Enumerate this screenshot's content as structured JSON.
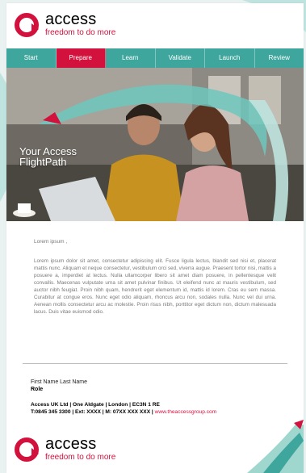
{
  "logo": {
    "brand": "access",
    "tagline": "freedom to do more"
  },
  "nav": [
    {
      "label": "Start",
      "active": false
    },
    {
      "label": "Prepare",
      "active": true
    },
    {
      "label": "Learn",
      "active": false
    },
    {
      "label": "Validate",
      "active": false
    },
    {
      "label": "Launch",
      "active": false
    },
    {
      "label": "Review",
      "active": false
    }
  ],
  "hero": {
    "title_line1": "Your Access",
    "title_line2": "FlightPath"
  },
  "email": {
    "greeting": "Lorem ipsum ,",
    "body": "Lorem ipsum dolor sit amet, consectetur adipiscing elit. Fusce ligula lectus, blandit sed nisi et, placerat mattis nunc. Aliquam et neque consectetur, vestibulum orci sed, viverra augue. Praesent tortor nisi, mattis a posuere a, imperdiet at lectus. Nulla ullamcorper libero sit amet diam posuere, in pellentesque velit convallis. Maecenas vulputate urna sit amet pulvinar finibus. Ut eleifend nunc at mauris vestibulum, sed auctor nibh feugiat. Proin nibh quam, hendrerit eget elementum id, mattis id lorem. Cras eu sem massa. Curabitur at congue eros. Nunc eget odio aliquam, rhoncus arcu non, sodales nulla. Nunc vel dui urna. Aenean mollis consectetur arcu ac molestie. Proin risus nibh, porttitor eget dictum non, dictum malesuada lacus. Duis vitae euismod odio."
  },
  "signature": {
    "name": "First Name Last Name",
    "role": "Role",
    "address": "Access UK Ltd | One Aldgate | London | EC3N 1 RE",
    "contact": "T:0845 345 3300 | Ext: XXXX | M: 07XX XXX XXX | ",
    "website": "www.theaccessgroup.com"
  },
  "colors": {
    "brand_red": "#d3113d",
    "nav_teal": "#3fa69d"
  }
}
